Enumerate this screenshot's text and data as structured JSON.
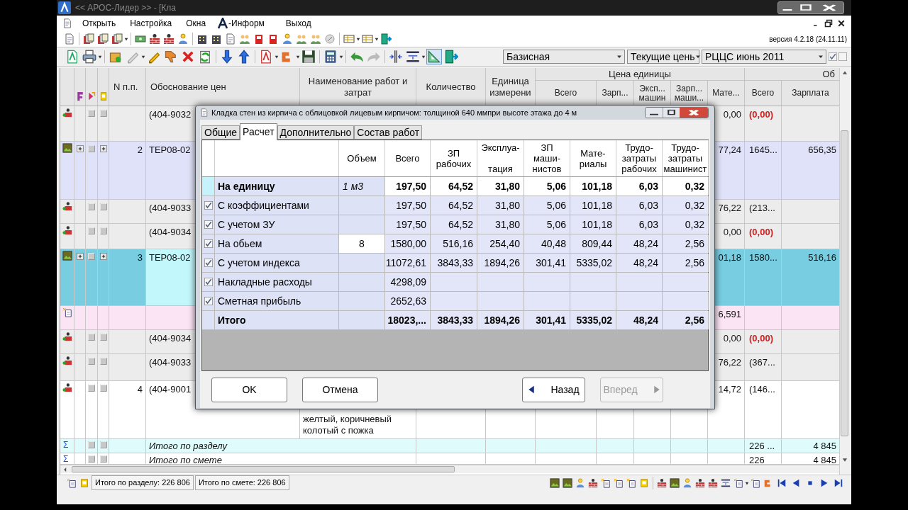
{
  "window": {
    "title": "<< АРОС-Лидер >> - [Кла"
  },
  "menu": [
    {
      "label": "Открыть",
      "logo": false
    },
    {
      "label": "Настройка",
      "logo": false
    },
    {
      "label": "Окна",
      "logo": false
    },
    {
      "label": "-Информ",
      "logo": true
    },
    {
      "label": "Выход",
      "logo": false
    }
  ],
  "version": "версия 4.2.18 (24.11.11)",
  "selectors": [
    {
      "value": "Базисная"
    },
    {
      "value": "Текущие цень"
    },
    {
      "value": "РЦЦС июнь 2011"
    }
  ],
  "toggles": [
    {
      "checked": true
    },
    {
      "checked": false
    }
  ],
  "grid": {
    "group_headers": [
      "Цена единицы",
      "Об"
    ],
    "columns": [
      "N п.п.",
      "Обоснование цен",
      "Наименование работ и затрат",
      "Количество",
      "Единица измерени",
      "Всего",
      "Зарп...",
      "Эксп... машин",
      "Зарп... маши...",
      "Мате...",
      "Всего",
      "Зарплата"
    ],
    "rows": [
      {
        "kind": "resource",
        "selected": false,
        "code": "(404-9032",
        "materials": "0,00",
        "total": "(0,00)",
        "alert": true
      },
      {
        "kind": "work",
        "selected": false,
        "number": "2",
        "code": "ТЕР08-02",
        "materials": "77,24",
        "total": "1645...",
        "salary": "656,35",
        "alert": false
      },
      {
        "kind": "resource",
        "selected": false,
        "code": "(404-9033",
        "materials": "76,22",
        "total": "(213...",
        "alert": false
      },
      {
        "kind": "resource",
        "selected": false,
        "code": "(404-9034",
        "materials": "0,00",
        "total": "(0,00)",
        "alert": true
      },
      {
        "kind": "work",
        "selected": true,
        "number": "3",
        "code": "ТЕР08-02",
        "materials": "01,18",
        "total": "1580...",
        "salary": "516,16",
        "alert": false
      },
      {
        "kind": "note",
        "selected": false,
        "materials": "6,591"
      },
      {
        "kind": "resource",
        "selected": false,
        "code": "(404-9034",
        "materials": "0,00",
        "total": "(0,00)",
        "alert": true
      },
      {
        "kind": "resource",
        "selected": false,
        "code": "(404-9033",
        "materials": "76,22",
        "total": "(367...",
        "alert": false
      },
      {
        "kind": "item",
        "selected": false,
        "number": "4",
        "code": "(404-9001",
        "name": "желтый, коричневый\nколотый с пожка",
        "materials": "14,72",
        "total": "(146...",
        "alert": false
      },
      {
        "kind": "section_total",
        "selected": false,
        "marker": "Σ",
        "label": "Итого по разделу",
        "total": "226 ...",
        "salary": "4 845",
        "alert": false
      },
      {
        "kind": "estimate_total",
        "selected": false,
        "marker": "Σ",
        "label": "Итого по смете",
        "total": "226",
        "salary": "4 845",
        "alert": false
      }
    ]
  },
  "dialog": {
    "title": "Кладка стен из кирпича с облицовкой лицевым кирпичом: толщиной 640 ммпри высоте этажа до 4 м",
    "tabs": [
      {
        "label": "Общие",
        "selected": false
      },
      {
        "label": "Расчет",
        "selected": true
      },
      {
        "label": "Дополнительно",
        "selected": false
      },
      {
        "label": "Состав работ",
        "selected": false
      }
    ],
    "columns": [
      "Объем",
      "Всего",
      "ЗП\nрабочих",
      "Эксплуа-\n\nтация",
      "ЗП\nмаши-\nнистов",
      "Мате-\nриалы",
      "Трудо-\nзатраты\nрабочих",
      "Трудо-\nзатраты\nмашинист"
    ],
    "rows": [
      {
        "kind": "unit",
        "label": "На единицу",
        "volume": "1 м3",
        "values": [
          "197,50",
          "64,52",
          "31,80",
          "5,06",
          "101,18",
          "6,03",
          "0,32"
        ]
      },
      {
        "kind": "check",
        "checked": true,
        "label": "С коэффициентами",
        "values": [
          "197,50",
          "64,52",
          "31,80",
          "5,06",
          "101,18",
          "6,03",
          "0,32"
        ]
      },
      {
        "kind": "check",
        "checked": true,
        "label": "С учетом ЗУ",
        "values": [
          "197,50",
          "64,52",
          "31,80",
          "5,06",
          "101,18",
          "6,03",
          "0,32"
        ]
      },
      {
        "kind": "input",
        "checked": true,
        "label": "На обьем",
        "volume": "8",
        "values": [
          "1580,00",
          "516,16",
          "254,40",
          "40,48",
          "809,44",
          "48,24",
          "2,56"
        ]
      },
      {
        "kind": "check",
        "checked": true,
        "label": "С учетом индекса",
        "values": [
          "11072,61",
          "3843,33",
          "1894,26",
          "301,41",
          "5335,02",
          "48,24",
          "2,56"
        ]
      },
      {
        "kind": "check",
        "checked": true,
        "label": "Накладные расходы",
        "values": [
          "4298,09"
        ]
      },
      {
        "kind": "check",
        "checked": true,
        "label": "Сметная прибыль",
        "values": [
          "2652,63"
        ]
      },
      {
        "kind": "total",
        "label": "Итого",
        "values": [
          "18023,...",
          "3843,33",
          "1894,26",
          "301,41",
          "5335,02",
          "48,24",
          "2,56"
        ]
      }
    ],
    "buttons": [
      {
        "kind": "plain",
        "label": "OK",
        "disabled": false
      },
      {
        "kind": "plain",
        "label": "Отмена",
        "disabled": false
      },
      {
        "kind": "back",
        "label": "Назад",
        "disabled": false
      },
      {
        "kind": "forward",
        "label": "Вперед",
        "disabled": true
      }
    ]
  },
  "status_bar": {
    "fields": [
      "Итого по разделу: 226 806",
      "Итого по смете: 226 806"
    ]
  }
}
